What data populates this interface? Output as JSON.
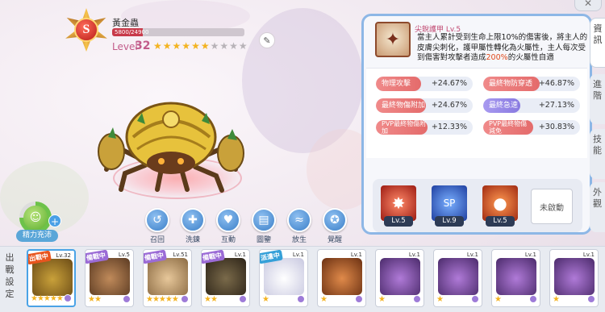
{
  "pet": {
    "rank": "S",
    "name": "黃金蟲",
    "hp_text": "5800/24900",
    "hp_fraction": 0.233,
    "level_label": "Level",
    "level": "32",
    "stars_filled": 6,
    "stars_total": 10
  },
  "energy": {
    "label": "精力充沛",
    "fraction": 0.75
  },
  "actions": [
    {
      "label": "召回",
      "icon": "recall-icon"
    },
    {
      "label": "洗鍊",
      "icon": "refine-icon"
    },
    {
      "label": "互動",
      "icon": "heart-icon"
    },
    {
      "label": "圖鑒",
      "icon": "book-icon"
    },
    {
      "label": "放生",
      "icon": "release-icon"
    },
    {
      "label": "覺醒",
      "icon": "awaken-icon"
    }
  ],
  "skill": {
    "name": "尖銳護甲",
    "level": "Lv.5",
    "desc_1": "當主人累計受到生命上限10%的傷害後，將主人的皮膚尖刺化，護甲屬性轉化為火屬性，主人每次受到傷害對攻擊者造成",
    "desc_highlight": "200%",
    "desc_2": "的火屬性自適"
  },
  "stats": [
    {
      "label": "物理攻擊",
      "value": "+24.67%",
      "color": "red"
    },
    {
      "label": "最終物防穿透",
      "value": "+46.87%",
      "color": "red"
    },
    {
      "label": "最終物傷附加",
      "value": "+24.67%",
      "color": "red"
    },
    {
      "label": "最終急速",
      "value": "+27.13%",
      "color": "purple"
    },
    {
      "label": "PVP最終物傷附加",
      "value": "+12.33%",
      "color": "red"
    },
    {
      "label": "PVP最終物傷減免",
      "value": "+30.83%",
      "color": "red"
    }
  ],
  "skill_slots": [
    {
      "level": "Lv.5",
      "icon": "claw-strike-icon"
    },
    {
      "level": "Lv.9",
      "icon": "sp-icon"
    },
    {
      "level": "Lv.5",
      "icon": "fire-orb-icon"
    }
  ],
  "unactivated_label": "未啟動",
  "side_tabs": [
    "資訊",
    "進階",
    "技能",
    "外觀"
  ],
  "roster": {
    "label": "出戰設定",
    "pets": [
      {
        "ribbon": "出戰中",
        "level": "Lv.32",
        "stars": "★★★★★",
        "selected": true
      },
      {
        "ribbon": "備戰中",
        "level": "Lv.5",
        "stars": "★★",
        "selected": false
      },
      {
        "ribbon": "備戰中",
        "level": "Lv.51",
        "stars": "★★★★★",
        "selected": false
      },
      {
        "ribbon": "備戰中",
        "level": "Lv.1",
        "stars": "★★",
        "selected": false
      },
      {
        "ribbon": "派遣中",
        "level": "Lv.1",
        "stars": "★",
        "selected": false
      },
      {
        "ribbon": "",
        "level": "Lv.1",
        "stars": "★",
        "selected": false
      },
      {
        "ribbon": "",
        "level": "Lv.1",
        "stars": "★",
        "selected": false
      },
      {
        "ribbon": "",
        "level": "Lv.1",
        "stars": "★",
        "selected": false
      },
      {
        "ribbon": "",
        "level": "Lv.1",
        "stars": "★",
        "selected": false
      },
      {
        "ribbon": "",
        "level": "Lv.1",
        "stars": "★",
        "selected": false
      }
    ]
  },
  "colors": {
    "panel_border": "#8db7e6",
    "stat_red": "#e46b6b",
    "stat_purple": "#8879e0",
    "accent_pink": "#c25c8a"
  }
}
